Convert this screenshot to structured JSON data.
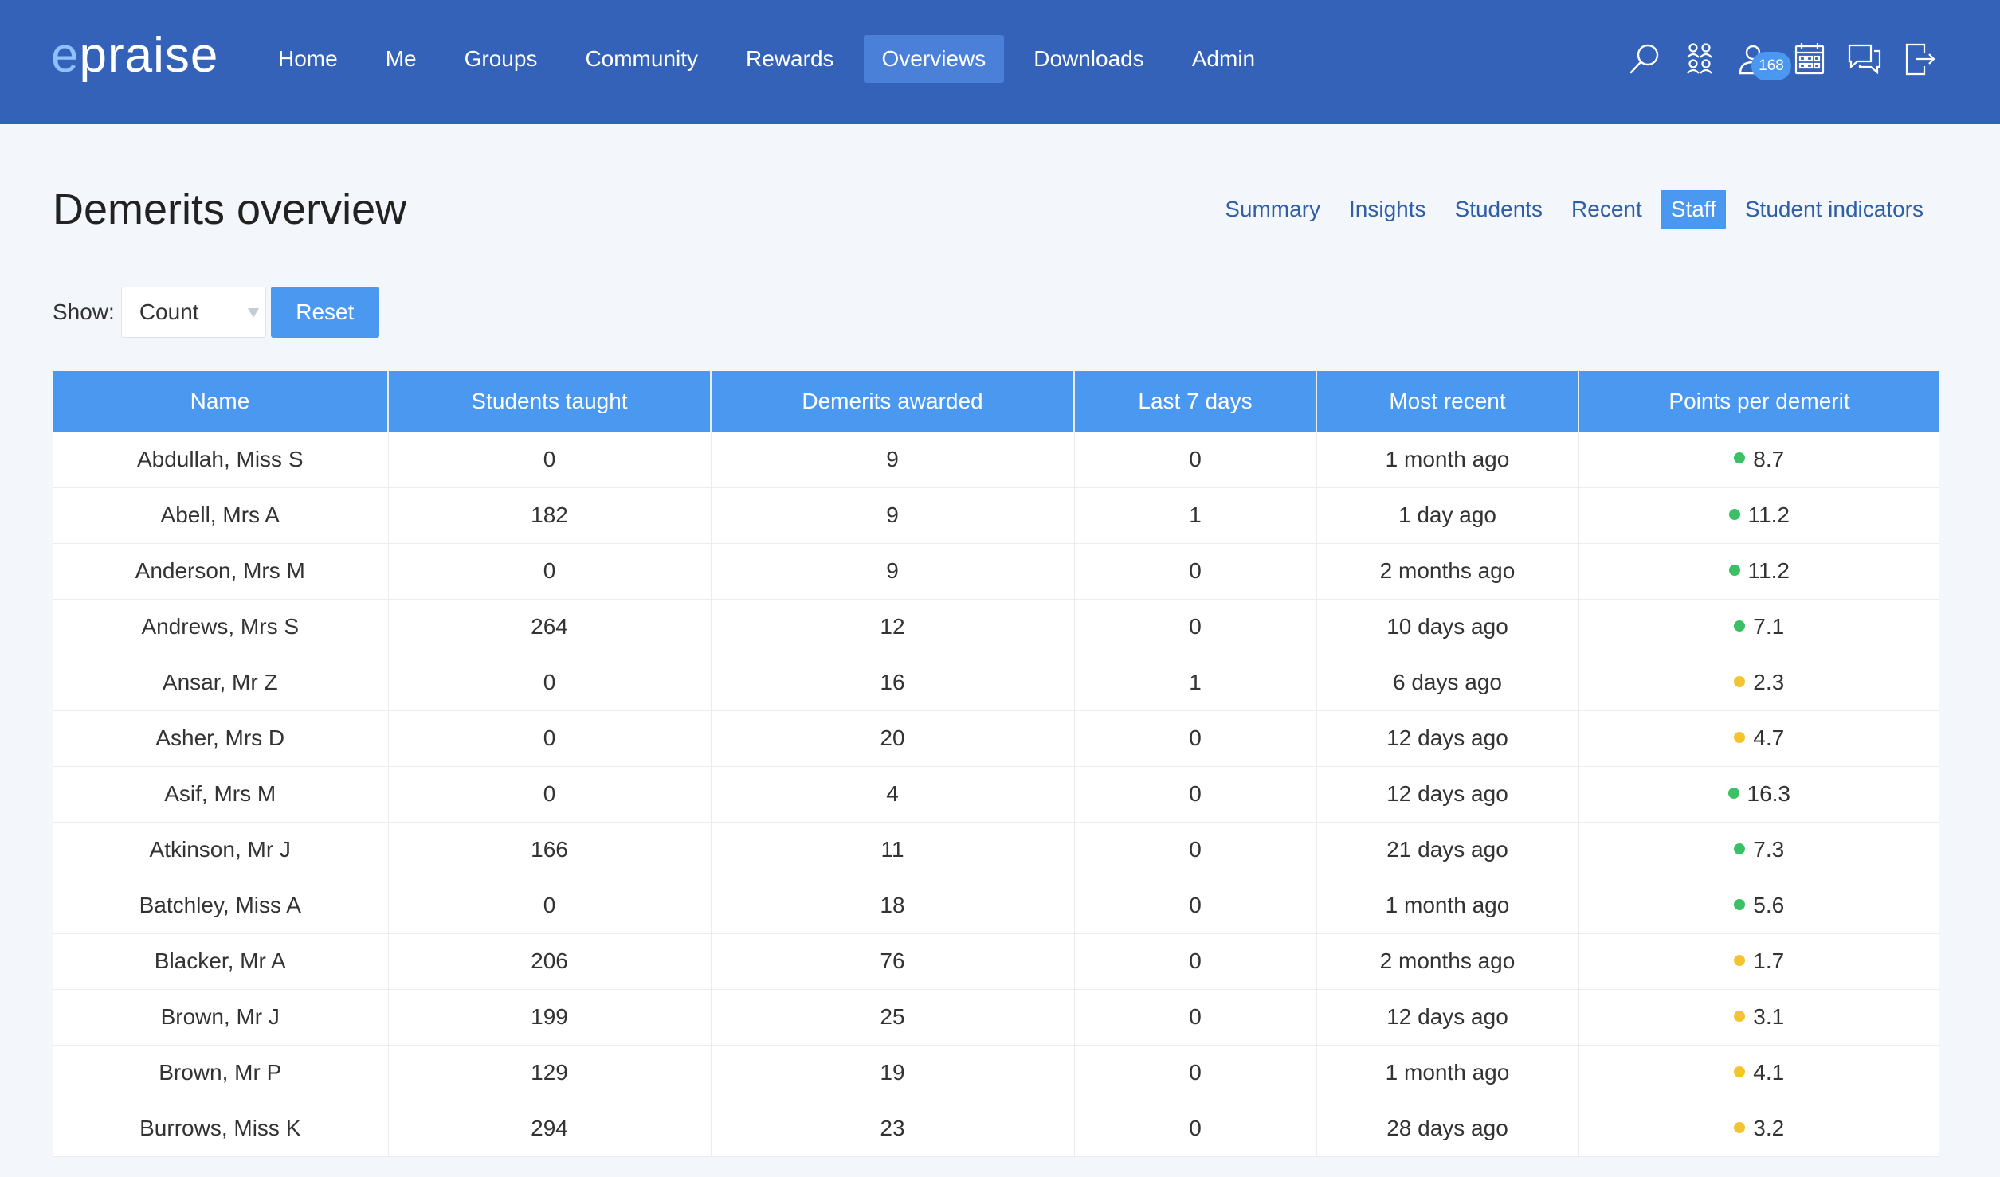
{
  "app": {
    "logo_e": "e",
    "logo_rest": "praise"
  },
  "nav": [
    {
      "label": "Home"
    },
    {
      "label": "Me"
    },
    {
      "label": "Groups"
    },
    {
      "label": "Community"
    },
    {
      "label": "Rewards"
    },
    {
      "label": "Overviews",
      "active": true
    },
    {
      "label": "Downloads"
    },
    {
      "label": "Admin"
    }
  ],
  "header_icons": [
    {
      "icon": "search-icon"
    },
    {
      "icon": "groups-icon"
    },
    {
      "icon": "user-notifications-icon",
      "badge": "168"
    },
    {
      "icon": "calendar-icon"
    },
    {
      "icon": "messages-icon"
    },
    {
      "icon": "logout-icon"
    }
  ],
  "page": {
    "title": "Demerits overview"
  },
  "subnav": [
    {
      "label": "Summary"
    },
    {
      "label": "Insights"
    },
    {
      "label": "Students"
    },
    {
      "label": "Recent"
    },
    {
      "label": "Staff",
      "active": true
    },
    {
      "label": "Student indicators"
    }
  ],
  "filter": {
    "label": "Show:",
    "selected": "Count",
    "reset_label": "Reset"
  },
  "colors": {
    "good": "#3cc065",
    "warn": "#f4c430"
  },
  "table": {
    "headers": [
      "Name",
      "Students taught",
      "Demerits awarded",
      "Last 7 days",
      "Most recent",
      "Points per demerit"
    ],
    "rows": [
      {
        "name": "Abdullah, Miss S",
        "taught": "0",
        "demerits": "9",
        "last7": "0",
        "recent": "1 month ago",
        "ppd": "8.7",
        "status": "good"
      },
      {
        "name": "Abell, Mrs A",
        "taught": "182",
        "demerits": "9",
        "last7": "1",
        "recent": "1 day ago",
        "ppd": "11.2",
        "status": "good"
      },
      {
        "name": "Anderson, Mrs M",
        "taught": "0",
        "demerits": "9",
        "last7": "0",
        "recent": "2 months ago",
        "ppd": "11.2",
        "status": "good"
      },
      {
        "name": "Andrews, Mrs S",
        "taught": "264",
        "demerits": "12",
        "last7": "0",
        "recent": "10 days ago",
        "ppd": "7.1",
        "status": "good"
      },
      {
        "name": "Ansar, Mr Z",
        "taught": "0",
        "demerits": "16",
        "last7": "1",
        "recent": "6 days ago",
        "ppd": "2.3",
        "status": "warn"
      },
      {
        "name": "Asher, Mrs D",
        "taught": "0",
        "demerits": "20",
        "last7": "0",
        "recent": "12 days ago",
        "ppd": "4.7",
        "status": "warn"
      },
      {
        "name": "Asif, Mrs M",
        "taught": "0",
        "demerits": "4",
        "last7": "0",
        "recent": "12 days ago",
        "ppd": "16.3",
        "status": "good"
      },
      {
        "name": "Atkinson, Mr J",
        "taught": "166",
        "demerits": "11",
        "last7": "0",
        "recent": "21 days ago",
        "ppd": "7.3",
        "status": "good"
      },
      {
        "name": "Batchley, Miss A",
        "taught": "0",
        "demerits": "18",
        "last7": "0",
        "recent": "1 month ago",
        "ppd": "5.6",
        "status": "good"
      },
      {
        "name": "Blacker, Mr A",
        "taught": "206",
        "demerits": "76",
        "last7": "0",
        "recent": "2 months ago",
        "ppd": "1.7",
        "status": "warn"
      },
      {
        "name": "Brown, Mr J",
        "taught": "199",
        "demerits": "25",
        "last7": "0",
        "recent": "12 days ago",
        "ppd": "3.1",
        "status": "warn"
      },
      {
        "name": "Brown, Mr P",
        "taught": "129",
        "demerits": "19",
        "last7": "0",
        "recent": "1 month ago",
        "ppd": "4.1",
        "status": "warn"
      },
      {
        "name": "Burrows, Miss K",
        "taught": "294",
        "demerits": "23",
        "last7": "0",
        "recent": "28 days ago",
        "ppd": "3.2",
        "status": "warn"
      }
    ]
  }
}
